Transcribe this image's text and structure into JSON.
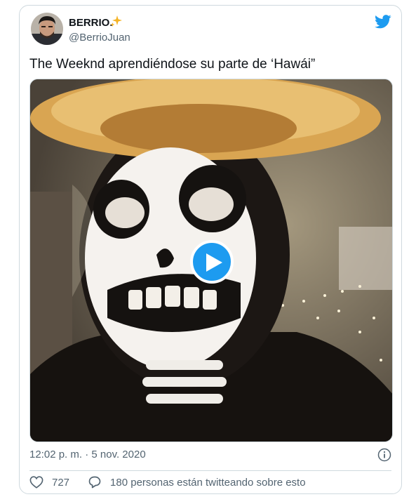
{
  "author": {
    "display_name": "BERRIO.",
    "handle": "@BerrioJuan",
    "badge_icon": "sparkles-icon"
  },
  "brand": {
    "icon": "twitter-bird-icon",
    "color": "#1d9bf0"
  },
  "tweet": {
    "text": "The Weeknd aprendiéndose su parte de ‘Hawái”",
    "timestamp": "12:02 p. m. · 5 nov. 2020"
  },
  "media": {
    "type": "video",
    "play_icon": "play-icon"
  },
  "actions": {
    "likes": "727",
    "conversation": "180 personas están twitteando sobre esto"
  },
  "colors": {
    "text_primary": "#0f1419",
    "text_secondary": "#536471",
    "border": "#cfd9de",
    "accent": "#1d9bf0",
    "sparkle": "#f5b324"
  }
}
